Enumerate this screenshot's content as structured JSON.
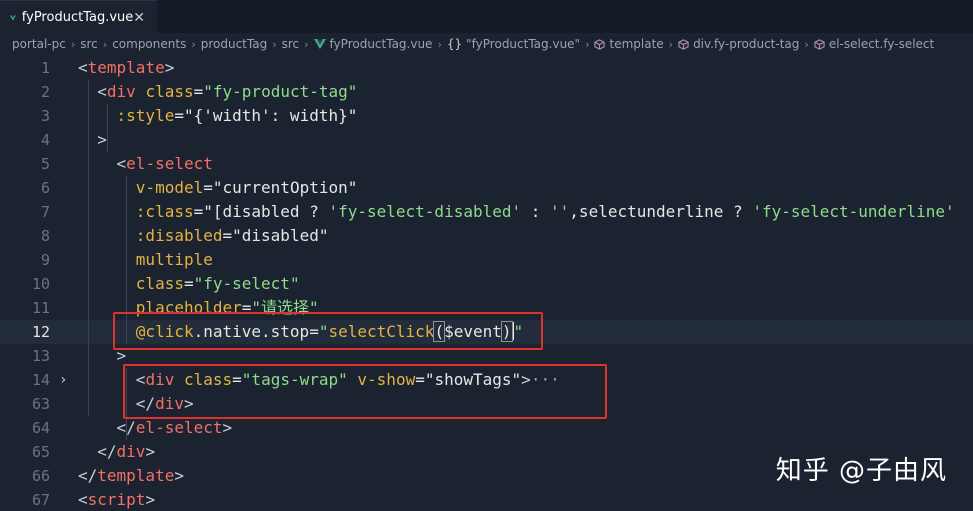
{
  "tab": {
    "title": "fyProductTag.vue",
    "close": "✕"
  },
  "breadcrumb": [
    {
      "label": "portal-pc",
      "icon": ""
    },
    {
      "label": "src",
      "icon": ""
    },
    {
      "label": "components",
      "icon": ""
    },
    {
      "label": "productTag",
      "icon": ""
    },
    {
      "label": "src",
      "icon": ""
    },
    {
      "label": "fyProductTag.vue",
      "icon": "vue-icon"
    },
    {
      "label": "\"fyProductTag.vue\"",
      "icon": "braces-icon"
    },
    {
      "label": "template",
      "icon": "cube-icon"
    },
    {
      "label": "div.fy-product-tag",
      "icon": "cube-icon"
    },
    {
      "label": "el-select.fy-select",
      "icon": "cube-icon"
    }
  ],
  "editor": {
    "current_line": "12",
    "lines": [
      {
        "num": "1",
        "fold": "",
        "tokens": [
          {
            "t": "<",
            "c": "br"
          },
          {
            "t": "template",
            "c": "tag"
          },
          {
            "t": ">",
            "c": "br"
          }
        ]
      },
      {
        "num": "2",
        "fold": "",
        "tokens": [
          {
            "t": "  <",
            "c": "br"
          },
          {
            "t": "div",
            "c": "tag"
          },
          {
            "t": " ",
            "c": "br"
          },
          {
            "t": "class",
            "c": "attr"
          },
          {
            "t": "=",
            "c": "white"
          },
          {
            "t": "\"fy-product-tag\"",
            "c": "str"
          }
        ]
      },
      {
        "num": "3",
        "fold": "",
        "tokens": [
          {
            "t": "    ",
            "c": "br"
          },
          {
            "t": ":style",
            "c": "attr"
          },
          {
            "t": "=",
            "c": "white"
          },
          {
            "t": "\"{'width': width}\"",
            "c": "white"
          }
        ]
      },
      {
        "num": "4",
        "fold": "",
        "tokens": [
          {
            "t": "  >",
            "c": "br"
          }
        ]
      },
      {
        "num": "5",
        "fold": "",
        "tokens": [
          {
            "t": "    <",
            "c": "br"
          },
          {
            "t": "el-select",
            "c": "tag"
          }
        ]
      },
      {
        "num": "6",
        "fold": "",
        "tokens": [
          {
            "t": "      ",
            "c": "br"
          },
          {
            "t": "v-model",
            "c": "attr"
          },
          {
            "t": "=",
            "c": "white"
          },
          {
            "t": "\"currentOption\"",
            "c": "white"
          }
        ]
      },
      {
        "num": "7",
        "fold": "",
        "tokens": [
          {
            "t": "      ",
            "c": "br"
          },
          {
            "t": ":class",
            "c": "attr"
          },
          {
            "t": "=",
            "c": "white"
          },
          {
            "t": "\"[disabled ? ",
            "c": "white"
          },
          {
            "t": "'fy-select-disabled'",
            "c": "str"
          },
          {
            "t": " : ",
            "c": "white"
          },
          {
            "t": "''",
            "c": "str"
          },
          {
            "t": ",selectunderline ? ",
            "c": "white"
          },
          {
            "t": "'fy-select-underline'",
            "c": "str"
          }
        ]
      },
      {
        "num": "8",
        "fold": "",
        "tokens": [
          {
            "t": "      ",
            "c": "br"
          },
          {
            "t": ":disabled",
            "c": "attr"
          },
          {
            "t": "=",
            "c": "white"
          },
          {
            "t": "\"disabled\"",
            "c": "white"
          }
        ]
      },
      {
        "num": "9",
        "fold": "",
        "tokens": [
          {
            "t": "      ",
            "c": "br"
          },
          {
            "t": "multiple",
            "c": "attr"
          }
        ]
      },
      {
        "num": "10",
        "fold": "",
        "tokens": [
          {
            "t": "      ",
            "c": "br"
          },
          {
            "t": "class",
            "c": "attr"
          },
          {
            "t": "=",
            "c": "white"
          },
          {
            "t": "\"fy-select\"",
            "c": "str"
          }
        ]
      },
      {
        "num": "11",
        "fold": "",
        "tokens": [
          {
            "t": "      ",
            "c": "br"
          },
          {
            "t": "placeholder",
            "c": "attr"
          },
          {
            "t": "=",
            "c": "white"
          },
          {
            "t": "\"请选择\"",
            "c": "str"
          }
        ]
      },
      {
        "num": "12",
        "fold": "",
        "tokens": [
          {
            "t": "      ",
            "c": "br"
          },
          {
            "t": "@click",
            "c": "attr"
          },
          {
            "t": ".native.stop",
            "c": "mod"
          },
          {
            "t": "=",
            "c": "white"
          },
          {
            "t": "\"",
            "c": "str"
          },
          {
            "t": "selectClick",
            "c": "fn"
          },
          {
            "t": "(",
            "c": "bracket"
          },
          {
            "t": "$event",
            "c": "event"
          },
          {
            "t": ")",
            "c": "bracket-cursor"
          },
          {
            "t": "\"",
            "c": "str"
          }
        ]
      },
      {
        "num": "13",
        "fold": "",
        "tokens": [
          {
            "t": "    >",
            "c": "br"
          }
        ]
      },
      {
        "num": "14",
        "fold": "›",
        "tokens": [
          {
            "t": "      <",
            "c": "br"
          },
          {
            "t": "div",
            "c": "tag"
          },
          {
            "t": " ",
            "c": "br"
          },
          {
            "t": "class",
            "c": "attr"
          },
          {
            "t": "=",
            "c": "white"
          },
          {
            "t": "\"tags-wrap\"",
            "c": "str"
          },
          {
            "t": " ",
            "c": "br"
          },
          {
            "t": "v-show",
            "c": "attr"
          },
          {
            "t": "=",
            "c": "white"
          },
          {
            "t": "\"showTags\"",
            "c": "white"
          },
          {
            "t": ">",
            "c": "br"
          },
          {
            "t": "···",
            "c": "ell"
          }
        ]
      },
      {
        "num": "63",
        "fold": "",
        "tokens": [
          {
            "t": "      </",
            "c": "br"
          },
          {
            "t": "div",
            "c": "tag"
          },
          {
            "t": ">",
            "c": "br"
          }
        ]
      },
      {
        "num": "64",
        "fold": "",
        "tokens": [
          {
            "t": "    </",
            "c": "br"
          },
          {
            "t": "el-select",
            "c": "tag"
          },
          {
            "t": ">",
            "c": "br"
          }
        ]
      },
      {
        "num": "65",
        "fold": "",
        "tokens": [
          {
            "t": "  </",
            "c": "br"
          },
          {
            "t": "div",
            "c": "tag"
          },
          {
            "t": ">",
            "c": "br"
          }
        ]
      },
      {
        "num": "66",
        "fold": "",
        "tokens": [
          {
            "t": "</",
            "c": "br"
          },
          {
            "t": "template",
            "c": "tag"
          },
          {
            "t": ">",
            "c": "br"
          }
        ]
      },
      {
        "num": "67",
        "fold": "",
        "tokens": [
          {
            "t": "<",
            "c": "br"
          },
          {
            "t": "script",
            "c": "tag"
          },
          {
            "t": ">",
            "c": "br"
          }
        ]
      }
    ]
  },
  "watermark": "知乎 @子由风",
  "colors": {
    "background": "#1b2330",
    "tag": "#f47067",
    "attribute": "#e3b341",
    "string": "#8ddb8c",
    "highlight_box": "#e0312f"
  }
}
